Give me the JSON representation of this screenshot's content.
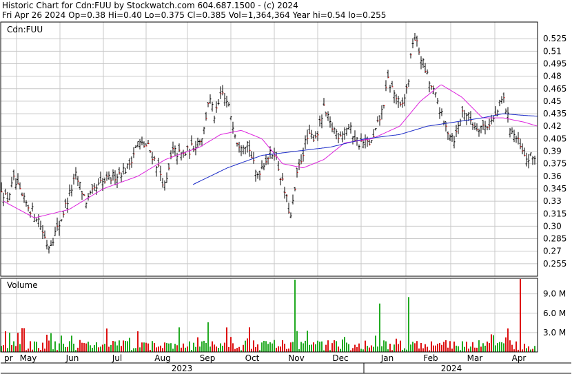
{
  "header": {
    "line1": "Historic Chart for Cdn:FUU by Stockwatch.com 604.687.1500 - (c) 2024",
    "line2": "Fri Apr 26 2024   Op=0.38   Hi=0.40   Lo=0.375   Cl=0.385   Vol=1,364,364   Year hi=0.54   lo=0.255"
  },
  "chart_data": [
    {
      "type": "candlestick",
      "title": "Cdn:FUU",
      "ylim": [
        0.24,
        0.545
      ],
      "y_ticks": [
        "0.525",
        "0.51",
        "0.495",
        "0.48",
        "0.465",
        "0.45",
        "0.435",
        "0.42",
        "0.405",
        "0.39",
        "0.375",
        "0.36",
        "0.345",
        "0.33",
        "0.315",
        "0.30",
        "0.285",
        "0.27",
        "0.255"
      ],
      "x_ticks": [
        "Apr",
        "May",
        "Jun",
        "Jul",
        "Aug",
        "Sep",
        "Oct",
        "Nov",
        "Dec",
        "Jan",
        "Feb",
        "Mar",
        "Apr"
      ],
      "year_labels": [
        "2023",
        "2024"
      ],
      "grid": true,
      "series": [
        {
          "kind": "price",
          "anchors": [
            [
              0,
              0.35
            ],
            [
              10,
              0.33
            ],
            [
              20,
              0.355
            ],
            [
              35,
              0.33
            ],
            [
              55,
              0.31
            ],
            [
              70,
              0.275
            ],
            [
              85,
              0.3
            ],
            [
              110,
              0.36
            ],
            [
              125,
              0.33
            ],
            [
              145,
              0.35
            ],
            [
              165,
              0.36
            ],
            [
              185,
              0.37
            ],
            [
              200,
              0.4
            ],
            [
              215,
              0.395
            ],
            [
              230,
              0.37
            ],
            [
              240,
              0.345
            ],
            [
              250,
              0.39
            ],
            [
              265,
              0.385
            ],
            [
              280,
              0.395
            ],
            [
              295,
              0.41
            ],
            [
              303,
              0.455
            ],
            [
              312,
              0.43
            ],
            [
              322,
              0.46
            ],
            [
              333,
              0.44
            ],
            [
              345,
              0.4
            ],
            [
              360,
              0.4
            ],
            [
              372,
              0.36
            ],
            [
              385,
              0.38
            ],
            [
              398,
              0.39
            ],
            [
              412,
              0.345
            ],
            [
              422,
              0.31
            ],
            [
              432,
              0.365
            ],
            [
              445,
              0.405
            ],
            [
              460,
              0.41
            ],
            [
              470,
              0.44
            ],
            [
              480,
              0.42
            ],
            [
              492,
              0.41
            ],
            [
              505,
              0.42
            ],
            [
              520,
              0.4
            ],
            [
              540,
              0.4
            ],
            [
              555,
              0.44
            ],
            [
              563,
              0.475
            ],
            [
              572,
              0.46
            ],
            [
              582,
              0.44
            ],
            [
              592,
              0.47
            ],
            [
              600,
              0.53
            ],
            [
              612,
              0.5
            ],
            [
              624,
              0.47
            ],
            [
              635,
              0.45
            ],
            [
              645,
              0.42
            ],
            [
              660,
              0.405
            ],
            [
              672,
              0.44
            ],
            [
              690,
              0.42
            ],
            [
              705,
              0.42
            ],
            [
              718,
              0.43
            ],
            [
              730,
              0.455
            ],
            [
              740,
              0.42
            ],
            [
              752,
              0.4
            ],
            [
              762,
              0.38
            ],
            [
              780,
              0.385
            ]
          ]
        },
        {
          "kind": "ma_short",
          "color": "#dd22dd",
          "anchors": [
            [
              5,
              0.33
            ],
            [
              50,
              0.31
            ],
            [
              100,
              0.32
            ],
            [
              150,
              0.345
            ],
            [
              200,
              0.36
            ],
            [
              240,
              0.38
            ],
            [
              290,
              0.395
            ],
            [
              320,
              0.41
            ],
            [
              350,
              0.415
            ],
            [
              380,
              0.405
            ],
            [
              410,
              0.375
            ],
            [
              440,
              0.37
            ],
            [
              470,
              0.38
            ],
            [
              500,
              0.4
            ],
            [
              540,
              0.405
            ],
            [
              580,
              0.42
            ],
            [
              610,
              0.45
            ],
            [
              640,
              0.47
            ],
            [
              670,
              0.455
            ],
            [
              700,
              0.43
            ],
            [
              730,
              0.43
            ],
            [
              760,
              0.425
            ],
            [
              780,
              0.42
            ]
          ]
        },
        {
          "kind": "ma_long",
          "color": "#1c2cc8",
          "anchors": [
            [
              280,
              0.35
            ],
            [
              330,
              0.37
            ],
            [
              380,
              0.385
            ],
            [
              430,
              0.39
            ],
            [
              480,
              0.395
            ],
            [
              530,
              0.405
            ],
            [
              580,
              0.41
            ],
            [
              620,
              0.42
            ],
            [
              660,
              0.425
            ],
            [
              700,
              0.43
            ],
            [
              730,
              0.435
            ],
            [
              760,
              0.433
            ],
            [
              780,
              0.432
            ]
          ]
        }
      ]
    },
    {
      "type": "bar",
      "title": "Volume",
      "ylim": [
        0,
        11.2
      ],
      "unit": "M",
      "y_ticks": [
        "9.0 M",
        "6.0 M",
        "3.0 M"
      ],
      "series": [
        {
          "kind": "volume",
          "spikes": [
            [
              75,
              2.9
            ],
            [
              200,
              3.2
            ],
            [
              303,
              4.6
            ],
            [
              330,
              3.8
            ],
            [
              428,
              11.2
            ],
            [
              552,
              7.5
            ],
            [
              594,
              8.5
            ],
            [
              716,
              2.6
            ],
            [
              754,
              11.3
            ]
          ]
        }
      ]
    }
  ]
}
